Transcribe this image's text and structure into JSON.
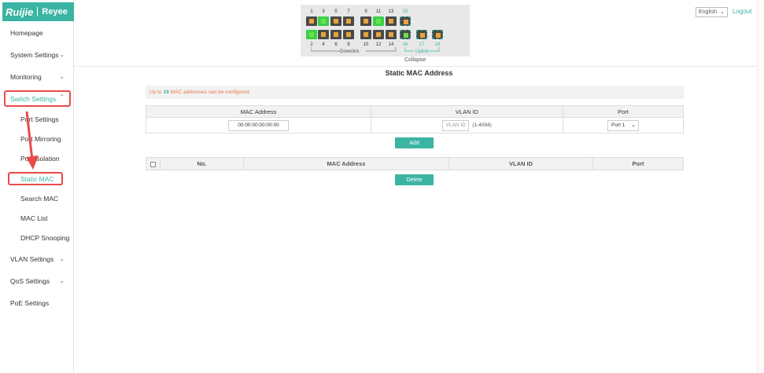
{
  "brand": {
    "name": "Ruijie",
    "sub": "Reyee"
  },
  "sidebar": {
    "items": [
      {
        "label": "Homepage"
      },
      {
        "label": "System Settings"
      },
      {
        "label": "Monitoring"
      },
      {
        "label": "Switch Settings"
      },
      {
        "label": "Port Settings"
      },
      {
        "label": "Port Mirroring"
      },
      {
        "label": "Port Isolation"
      },
      {
        "label": "Static MAC"
      },
      {
        "label": "Search MAC"
      },
      {
        "label": "MAC List"
      },
      {
        "label": "DHCP Snooping"
      },
      {
        "label": "VLAN Settings"
      },
      {
        "label": "QoS Settings"
      },
      {
        "label": "PoE Settings"
      }
    ]
  },
  "switch_panel": {
    "top_ports": [
      "1",
      "3",
      "5",
      "7",
      "9",
      "11",
      "13",
      "15"
    ],
    "bottom_ports": [
      "2",
      "4",
      "6",
      "8",
      "10",
      "12",
      "14",
      "16"
    ],
    "uplink_ports": [
      "17",
      "18"
    ],
    "downlink_label": "Downlink",
    "uplink_label": "Uplink",
    "collapse_label": "Collapse"
  },
  "header": {
    "language": "English",
    "logout": "Logout"
  },
  "page": {
    "title": "Static MAC Address",
    "tip_prefix": "Up to",
    "tip_count": "18",
    "tip_suffix": "MAC addresses can be configured."
  },
  "form": {
    "col_mac": "MAC Address",
    "col_vlan": "VLAN ID",
    "col_port": "Port",
    "mac_value": "00:00:00:00:00:00",
    "vlan_placeholder": "VLAN ID",
    "vlan_range": "(1-4094)",
    "port_value": "Port 1",
    "add_button": "Add"
  },
  "list": {
    "col_no": "No.",
    "col_mac": "MAC Address",
    "col_vlan": "VLAN ID",
    "col_port": "Port",
    "delete_button": "Delete"
  },
  "colors": {
    "accent": "#3ab4a3",
    "highlight": "#e84a4a",
    "tip_text": "#e8734a"
  }
}
